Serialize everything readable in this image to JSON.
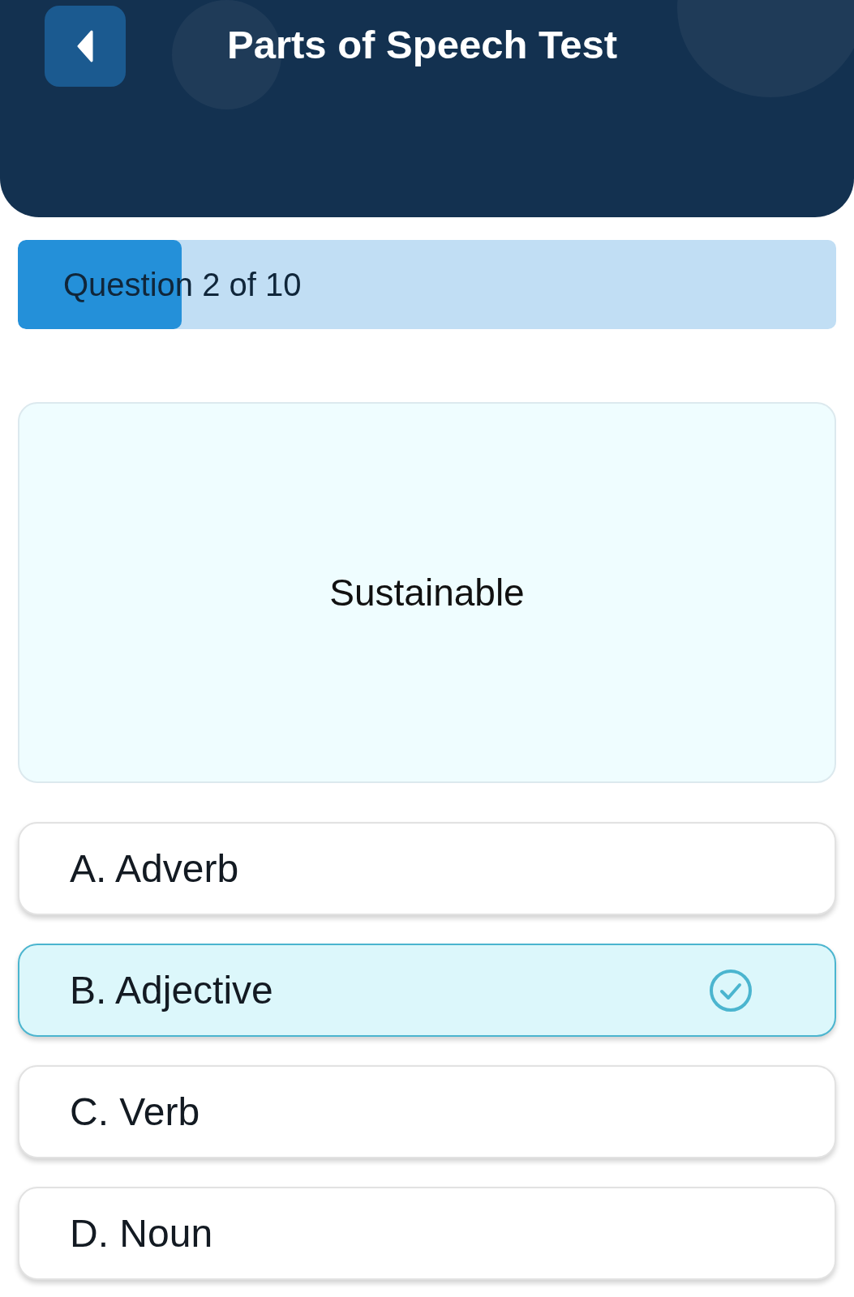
{
  "header": {
    "title": "Parts of Speech Test"
  },
  "progress": {
    "label": "Question 2 of 10",
    "level": 0.2
  },
  "question": {
    "word": "Sustainable"
  },
  "options": [
    {
      "label": "A. Adverb",
      "selected": false
    },
    {
      "label": "B. Adjective",
      "selected": true
    },
    {
      "label": "C. Verb",
      "selected": false
    },
    {
      "label": "D. Noun",
      "selected": false
    }
  ]
}
